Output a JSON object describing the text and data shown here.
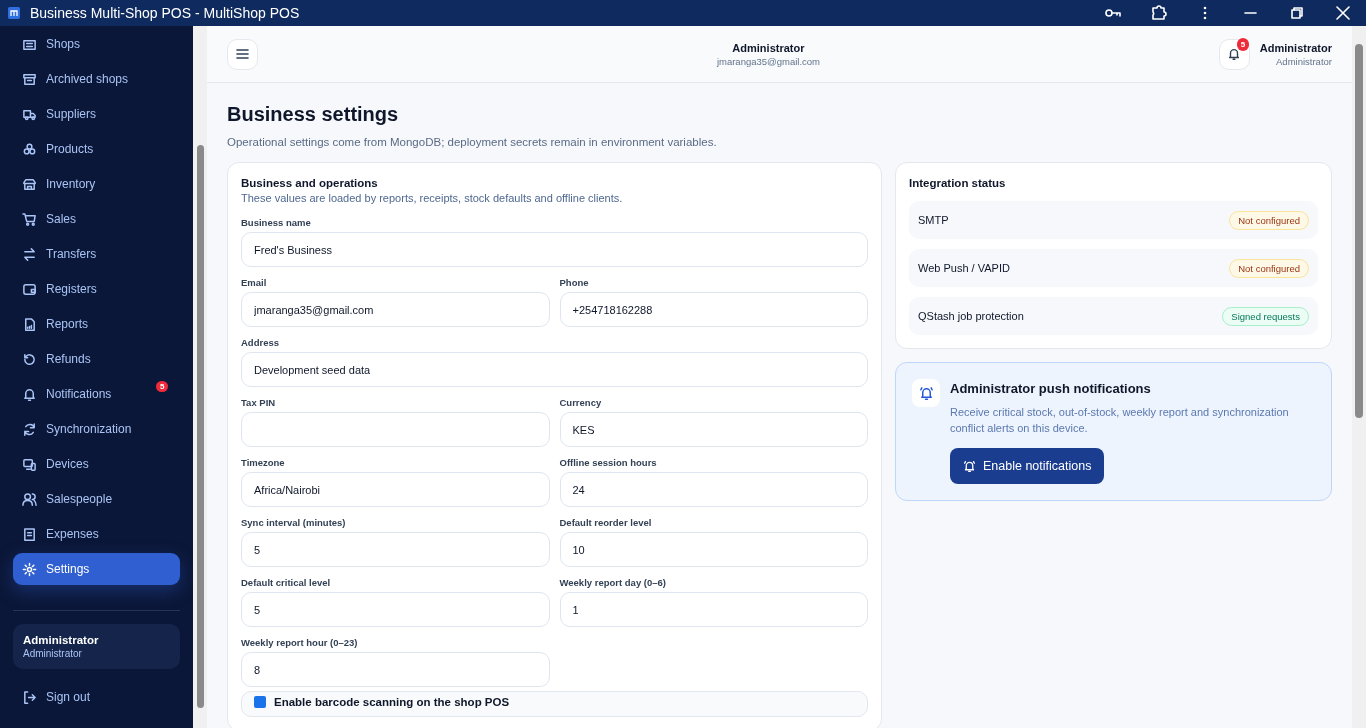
{
  "window": {
    "title": "Business Multi-Shop POS - MultiShop POS"
  },
  "sidebar": {
    "items": [
      {
        "label": "Shops",
        "selected": false
      },
      {
        "label": "Archived shops",
        "selected": false
      },
      {
        "label": "Suppliers",
        "selected": false
      },
      {
        "label": "Products",
        "selected": false
      },
      {
        "label": "Inventory",
        "selected": false
      },
      {
        "label": "Sales",
        "selected": false
      },
      {
        "label": "Transfers",
        "selected": false
      },
      {
        "label": "Registers",
        "selected": false
      },
      {
        "label": "Reports",
        "selected": false
      },
      {
        "label": "Refunds",
        "selected": false
      },
      {
        "label": "Notifications",
        "selected": false,
        "badge": "5"
      },
      {
        "label": "Synchronization",
        "selected": false
      },
      {
        "label": "Devices",
        "selected": false
      },
      {
        "label": "Salespeople",
        "selected": false
      },
      {
        "label": "Expenses",
        "selected": false
      },
      {
        "label": "Settings",
        "selected": true
      }
    ],
    "user": {
      "name": "Administrator",
      "role": "Administrator"
    },
    "sign_out": "Sign out"
  },
  "header": {
    "name": "Administrator",
    "email": "jmaranga35@gmail.com",
    "notification_count": "5",
    "profile": {
      "name": "Administrator",
      "role": "Administrator"
    }
  },
  "page": {
    "title": "Business settings",
    "subtitle": "Operational settings come from MongoDB; deployment secrets remain in environment variables."
  },
  "business_card": {
    "title": "Business and operations",
    "subtitle": "These values are loaded by reports, receipts, stock defaults and offline clients.",
    "fields": [
      {
        "label": "Business name",
        "value": "Fred's Business",
        "wide": true
      },
      {
        "label": "Email",
        "value": "jmaranga35@gmail.com",
        "wide": false
      },
      {
        "label": "Phone",
        "value": "+254718162288",
        "wide": false
      },
      {
        "label": "Address",
        "value": "Development seed data",
        "wide": true
      },
      {
        "label": "Tax PIN",
        "wide": false
      },
      {
        "label": "Currency",
        "value": "KES",
        "wide": false
      },
      {
        "label": "Timezone",
        "value": "Africa/Nairobi",
        "wide": false
      },
      {
        "label": "Offline session hours",
        "value": "24",
        "wide": false
      },
      {
        "label": "Sync interval (minutes)",
        "value": "5",
        "wide": false
      },
      {
        "label": "Default reorder level",
        "value": "10",
        "wide": false
      },
      {
        "label": "Default critical level",
        "value": "5",
        "wide": false
      },
      {
        "label": "Weekly report day (0–6)",
        "value": "1",
        "wide": false
      },
      {
        "label": "Weekly report hour (0–23)",
        "value": "8",
        "wide": false
      }
    ],
    "checkbox": {
      "label": "Enable barcode scanning on the shop POS",
      "checked": true
    }
  },
  "integration": {
    "title": "Integration status",
    "items": [
      {
        "name": "SMTP",
        "status": "Not configured",
        "kind": "warning"
      },
      {
        "name": "Web Push / VAPID",
        "status": "Not configured",
        "kind": "warning"
      },
      {
        "name": "QStash job protection",
        "status": "Signed requests",
        "kind": "ok"
      }
    ]
  },
  "push": {
    "title": "Administrator push notifications",
    "description": "Receive critical stock, out-of-stock, weekly report and synchronization conflict alerts on this device.",
    "button": "Enable notifications"
  }
}
